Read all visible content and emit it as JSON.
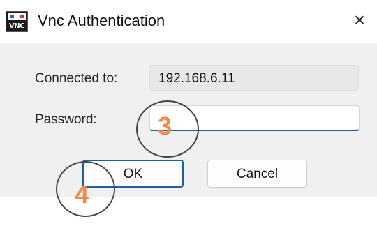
{
  "window": {
    "title": "Vnc Authentication",
    "icon": "vnc-app-icon",
    "icon_text": "VNC",
    "close_label": "×"
  },
  "form": {
    "connected_label": "Connected to:",
    "connected_value": "192.168.6.11",
    "password_label": "Password:",
    "password_value": ""
  },
  "buttons": {
    "ok": "OK",
    "cancel": "Cancel"
  },
  "annotations": {
    "step3": "3",
    "step4": "4"
  },
  "colors": {
    "accent": "#1c5ea8",
    "annotation_number": "#f28a46"
  }
}
